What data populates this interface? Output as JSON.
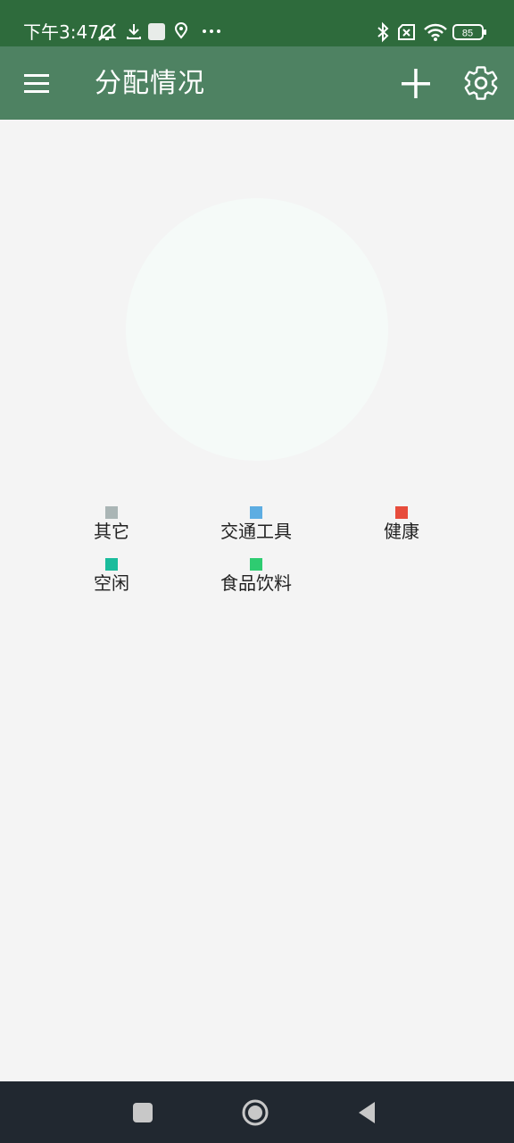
{
  "status_bar": {
    "time": "下午3:47",
    "battery_level": "85",
    "icons": [
      "mute-icon",
      "download-icon",
      "app-square-icon",
      "location-icon",
      "more-dots-icon",
      "bluetooth-icon",
      "no-sim-icon",
      "wifi-icon",
      "battery-icon"
    ]
  },
  "app_bar": {
    "title": "分配情况",
    "menu_icon": "menu-icon",
    "add_icon": "plus-icon",
    "settings_icon": "gear-icon"
  },
  "chart_data": {
    "type": "pie",
    "values": [],
    "empty_color": "#f5faf8",
    "legend": [
      {
        "label": "其它",
        "color": "#aab5b5"
      },
      {
        "label": "交通工具",
        "color": "#5dade2"
      },
      {
        "label": "健康",
        "color": "#e74c3c"
      },
      {
        "label": "空闲",
        "color": "#1abc9c"
      },
      {
        "label": "食品饮料",
        "color": "#2ecc71"
      }
    ]
  },
  "nav_bar": {
    "icons": [
      "recent-apps-icon",
      "home-icon",
      "back-icon"
    ]
  },
  "colors": {
    "status_bar": "#2e6b3c",
    "app_bar": "#4e8262",
    "background": "#f4f4f4",
    "nav_bar": "#212830"
  }
}
